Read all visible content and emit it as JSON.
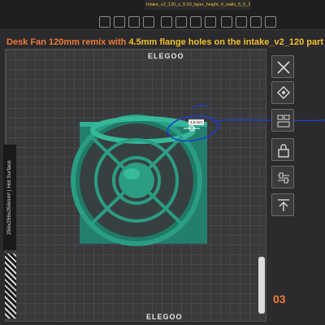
{
  "window": {
    "file_tab": "Intake_v2_120_x_0.20_layer_height_4_walls_5_5_30%_..."
  },
  "overlay": {
    "title_part1": "Desk Fan 120mm remix with ",
    "title_part2": "4.5mm flange holes on the intake_v2_120 part"
  },
  "plate": {
    "brand_top": "ELEGOO",
    "brand_bottom": "ELEGOO",
    "side_label": "256x256x256mm³ | Hot Surface",
    "plate_number": "03",
    "dimension_label": "4.5 mm"
  },
  "right_toolbar": {
    "tools": [
      "close-icon",
      "paint-icon",
      "layout-icon",
      "lock-icon",
      "settings-icon",
      "arrow-up-icon"
    ]
  },
  "colors": {
    "model": "#2a9d84",
    "accent_orange": "#f07a35",
    "accent_yellow": "#f4c028",
    "annotation_blue": "#1a3fd6"
  }
}
